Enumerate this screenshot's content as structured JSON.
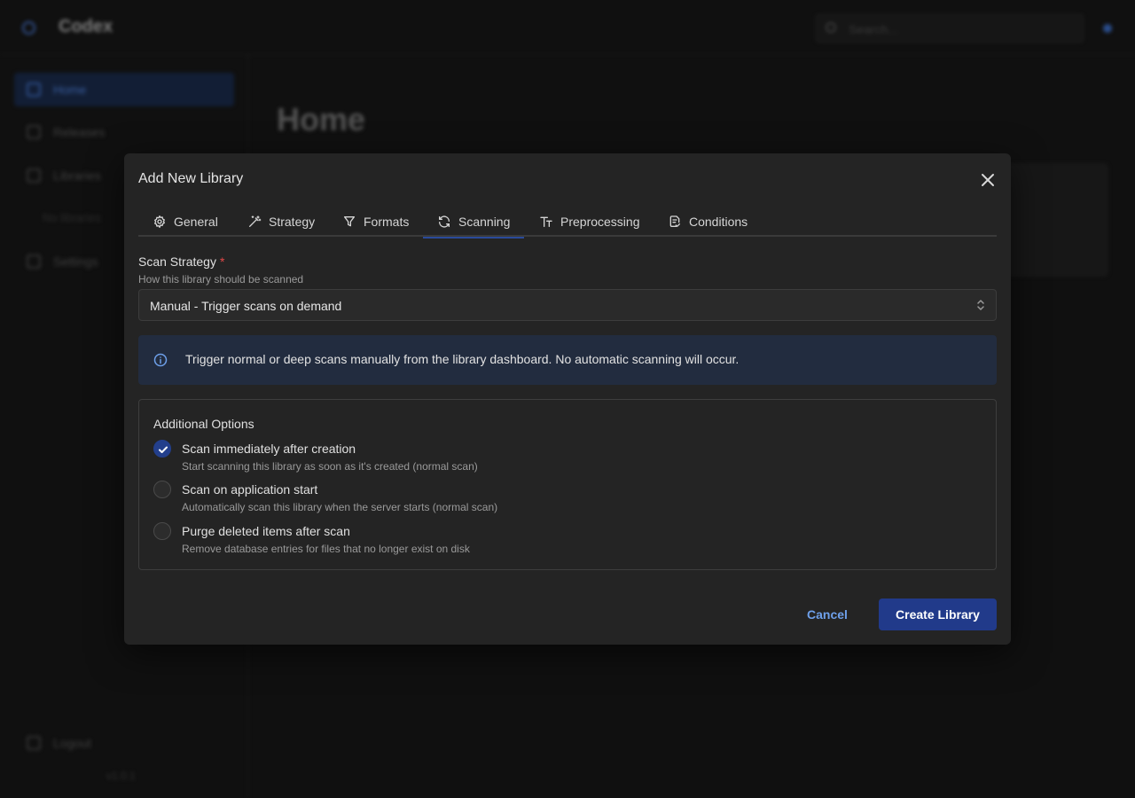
{
  "app": {
    "title": "Codex",
    "search_placeholder": "Search...",
    "page_title": "Home",
    "version": "v1.0.1"
  },
  "sidebar": {
    "items": [
      {
        "label": "Home",
        "icon": "home-icon",
        "active": true
      },
      {
        "label": "Releases",
        "icon": "file-icon",
        "active": false
      },
      {
        "label": "Libraries",
        "icon": "library-icon",
        "active": false
      },
      {
        "label": "Settings",
        "icon": "gear-icon",
        "active": false
      }
    ],
    "libraries_empty": "No libraries",
    "logout_label": "Logout"
  },
  "modal": {
    "title": "Add New Library",
    "tabs": [
      {
        "label": "General",
        "icon": "gear-icon"
      },
      {
        "label": "Strategy",
        "icon": "wand-icon"
      },
      {
        "label": "Formats",
        "icon": "filter-icon"
      },
      {
        "label": "Scanning",
        "icon": "refresh-icon",
        "active": true
      },
      {
        "label": "Preprocessing",
        "icon": "text-size-icon"
      },
      {
        "label": "Conditions",
        "icon": "file-check-icon"
      }
    ],
    "scan_strategy": {
      "label": "Scan Strategy",
      "required_mark": "*",
      "description": "How this library should be scanned",
      "value": "Manual - Trigger scans on demand"
    },
    "info_text": "Trigger normal or deep scans manually from the library dashboard. No automatic scanning will occur.",
    "options": {
      "legend": "Additional Options",
      "items": [
        {
          "label": "Scan immediately after creation",
          "description": "Start scanning this library as soon as it's created (normal scan)",
          "checked": true
        },
        {
          "label": "Scan on application start",
          "description": "Automatically scan this library when the server starts (normal scan)",
          "checked": false
        },
        {
          "label": "Purge deleted items after scan",
          "description": "Remove database entries for files that no longer exist on disk",
          "checked": false
        }
      ]
    },
    "cancel_label": "Cancel",
    "create_label": "Create Library"
  },
  "colors": {
    "accent": "#213a8a",
    "link": "#6ea0ea",
    "info_bg": "#222c3f",
    "required": "#e34848"
  }
}
